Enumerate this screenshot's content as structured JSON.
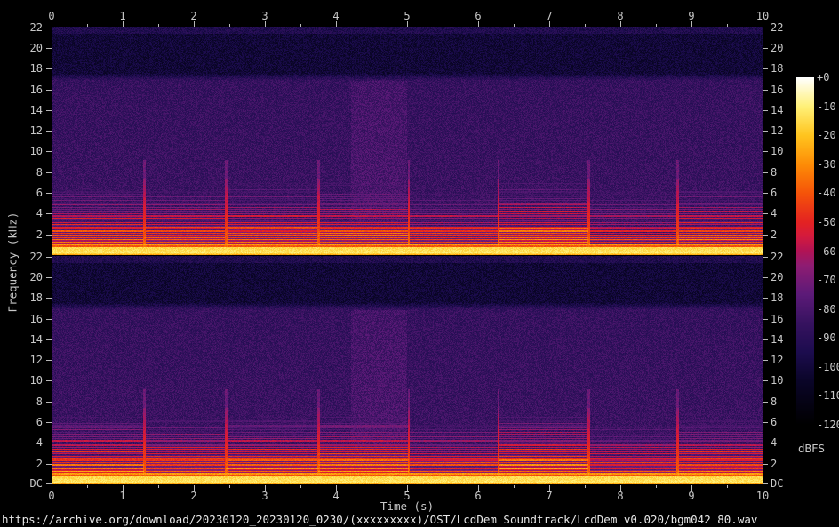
{
  "footer": {
    "url": "https://archive.org/download/20230120_20230120_0230/(xxxxxxxxx)/OST/LcdDem Soundtrack/LcdDem v0.020/bgm042 80.wav"
  },
  "colors": {
    "background": "#000000",
    "axis_text": "#c8c8c8",
    "footer_text": "#e8e8e8",
    "tick": "#b8b8b8"
  },
  "chart_data": {
    "type": "heatmap",
    "subtype": "stereo-audio-spectrogram",
    "panels": [
      {
        "id": "upper"
      },
      {
        "id": "lower"
      }
    ],
    "x_axis": {
      "label": "Time (s)",
      "min": 0,
      "max": 10,
      "major_ticks": [
        0,
        1,
        2,
        3,
        4,
        5,
        6,
        7,
        8,
        9,
        10
      ],
      "minor_tick_step": 0.5
    },
    "y_axis": {
      "label": "Frequency (kHz)",
      "min_khz": 0,
      "max_khz": 22.05,
      "tick_labels": [
        "22",
        "20",
        "18",
        "16",
        "14",
        "12",
        "10",
        "8",
        "6",
        "4",
        "2"
      ],
      "dc_label": "DC",
      "labels_on_both_sides": true
    },
    "colorbar": {
      "label": "dBFS",
      "max_db": 0,
      "min_db": -120,
      "tick_labels": [
        "+0",
        "-10",
        "-20",
        "-30",
        "-40",
        "-50",
        "-60",
        "-70",
        "-80",
        "-90",
        "-100",
        "-110",
        "-120"
      ],
      "palette_stops": [
        [
          -120,
          "#000000"
        ],
        [
          -105,
          "#0a0528"
        ],
        [
          -95,
          "#1c0c4e"
        ],
        [
          -85,
          "#36125f"
        ],
        [
          -75,
          "#5c1a78"
        ],
        [
          -65,
          "#8e1c72"
        ],
        [
          -60,
          "#b11355"
        ],
        [
          -55,
          "#d31a3e"
        ],
        [
          -50,
          "#e32222"
        ],
        [
          -40,
          "#f55309"
        ],
        [
          -30,
          "#fd8c06"
        ],
        [
          -20,
          "#ffc41e"
        ],
        [
          -10,
          "#fff077"
        ],
        [
          0,
          "#ffffff"
        ]
      ]
    },
    "content": {
      "noise_floor_db": -85,
      "hf_quiet_band": {
        "from_khz": 17.3,
        "to_khz": 21.35,
        "level_db": -101
      },
      "top_edge_strip": {
        "from_khz": 21.35,
        "to_khz": 22.05,
        "level_db": -94
      },
      "low_freq_energy": {
        "dc_band_db": -25,
        "bright_band_khz": [
          0.17,
          0.8
        ],
        "bright_band_db": -12,
        "harmonic_spacing_khz": 0.21,
        "harmonics_visible_up_to_khz": 5.0
      },
      "section_boundaries_s": [
        1.3,
        2.45,
        3.75,
        5.02,
        6.28,
        7.55,
        8.8
      ],
      "section_strengths": [
        1.0,
        0.97,
        1.0,
        1.02,
        0.9,
        1.06,
        0.85,
        0.98
      ],
      "bright_column_s": [
        4.2,
        5.0
      ]
    }
  }
}
